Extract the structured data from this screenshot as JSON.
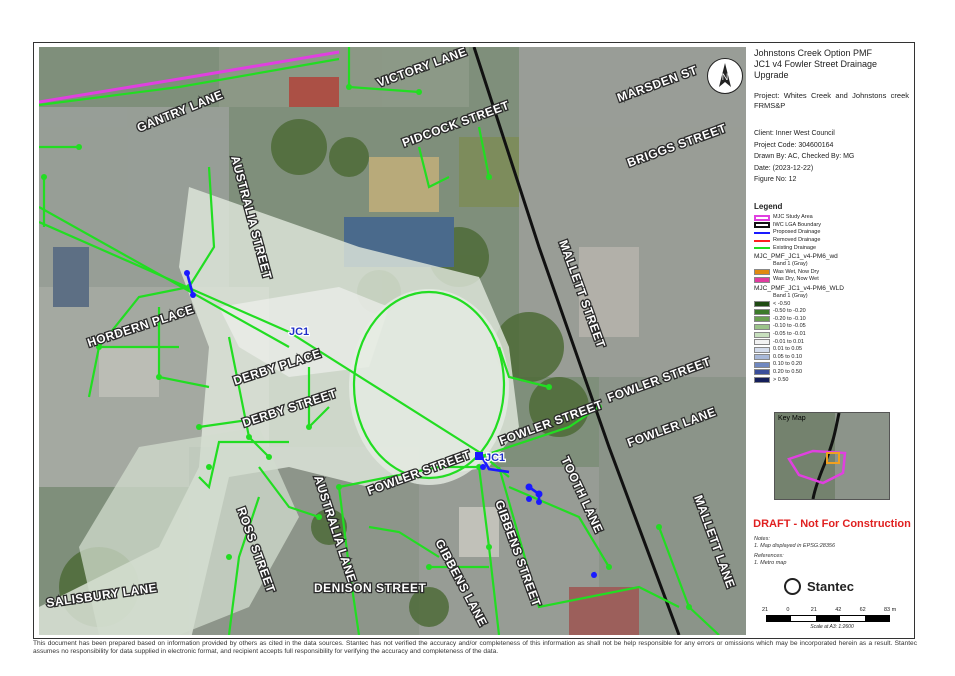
{
  "title_block": {
    "title_lines": [
      "Johnstons Creek Option PMF",
      "JC1 v4 Fowler Street Drainage",
      "Upgrade"
    ],
    "project_label": "Project:",
    "project_value": "Whites Creek and Johnstons creek FRMS&P",
    "client": "Client:  Inner West Council",
    "project_code": "Project Code:  304600164",
    "drawn_by": "Drawn By:  AC, Checked By: MG",
    "date": "Date:  (2023-12-22)",
    "figure_no": "Figure No:  12"
  },
  "legend": {
    "heading": "Legend",
    "line_items": [
      {
        "label": "MJC Study Area",
        "color": "#e040e0",
        "style": "double"
      },
      {
        "label": "IWC LGA Boundary",
        "color": "#111111",
        "style": "double"
      },
      {
        "label": "Proposed Drainage",
        "color": "#1a1aff",
        "style": "line"
      },
      {
        "label": "Removed Drainage",
        "color": "#ff2020",
        "style": "line"
      },
      {
        "label": "Existing Drainage",
        "color": "#22dd22",
        "style": "line"
      }
    ],
    "layer1_title": "MJC_PMF_JC1_v4-PM6_wd",
    "layer1_band": "Band 1 (Gray)",
    "layer1_items": [
      {
        "label": "Was Wet, Now Dry",
        "color": "#e08a10"
      },
      {
        "label": "Was Dry, Now Wet",
        "color": "#e03ca0"
      }
    ],
    "layer2_title": "MJC_PMF_JC1_v4-PM6_WLD",
    "layer2_band": "Band 1 (Gray)",
    "layer2_items": [
      {
        "label": "< -0.50",
        "color": "#1e4a12"
      },
      {
        "label": "-0.50 to -0.20",
        "color": "#3c7a2a"
      },
      {
        "label": "-0.20 to -0.10",
        "color": "#6aa050"
      },
      {
        "label": "-0.10 to -0.05",
        "color": "#9cc48a"
      },
      {
        "label": "-0.05 to -0.01",
        "color": "#c8e0be"
      },
      {
        "label": "-0.01 to 0.01",
        "color": "#f2f2f2"
      },
      {
        "label": "0.01 to 0.05",
        "color": "#d4dcec"
      },
      {
        "label": "0.05 to 0.10",
        "color": "#a8b8d8"
      },
      {
        "label": "0.10 to 0.20",
        "color": "#7088c0"
      },
      {
        "label": "0.20 to 0.50",
        "color": "#3a4e9a"
      },
      {
        "label": "> 0.50",
        "color": "#141e5a"
      }
    ]
  },
  "key_map_label": "Key Map",
  "draft_text": "DRAFT - Not For Construction",
  "notes_heading": "Notes:",
  "notes_text": "1. Map displayed in EPSG:28356",
  "references_heading": "References:",
  "references_text": "1. Metro map",
  "brand": "Stantec",
  "scale": {
    "ticks": [
      "21",
      "0",
      "21",
      "42",
      "62",
      "83 m"
    ],
    "label": "Scale at A3: 1:2600"
  },
  "north_label": "N",
  "street_labels": {
    "victory_lane": "VICTORY LANE",
    "marsden": "MARSDEN ST",
    "gantry": "GANTRY LANE",
    "pidcock": "PIDCOCK STREET",
    "briggs": "BRIGGS STREET",
    "australia_north": "AUSTRALIA STREET",
    "mallett": "MALLETT STREET",
    "hordern": "HORDERN PLACE",
    "derby_place": "DERBY PLACE",
    "derby_street": "DERBY STREET",
    "fowler_east": "FOWLER STREET",
    "fowler_mid": "FOWLER STREET",
    "fowler_west": "FOWLER STREET",
    "fowler_lane": "FOWLER LANE",
    "tooth_lane": "TOOTH LANE",
    "mallett_lane": "MALLETT LANE",
    "australia_lane": "AUSTRALIA LANE",
    "ross": "ROSS STREET",
    "gibbens_street": "GIBBENS STREET",
    "gibbens_lane": "GIBBENS LANE",
    "denison": "DENISON STREET",
    "salisbury": "SALISBURY LANE"
  },
  "jc_labels": {
    "upper": "JC1",
    "lower": "JC1"
  },
  "disclaimer": "This document has been prepared based on information provided by others as cited in the data sources. Stantec has not verified the accuracy and/or completeness of this information as shall not be help responsible for any errors or omissions which may be incorporated herein as a result. Stantec assumes no responsibility for data supplied in electronic format, and recipient accepts full responsibility for verifying the accuracy and completeness of the data."
}
